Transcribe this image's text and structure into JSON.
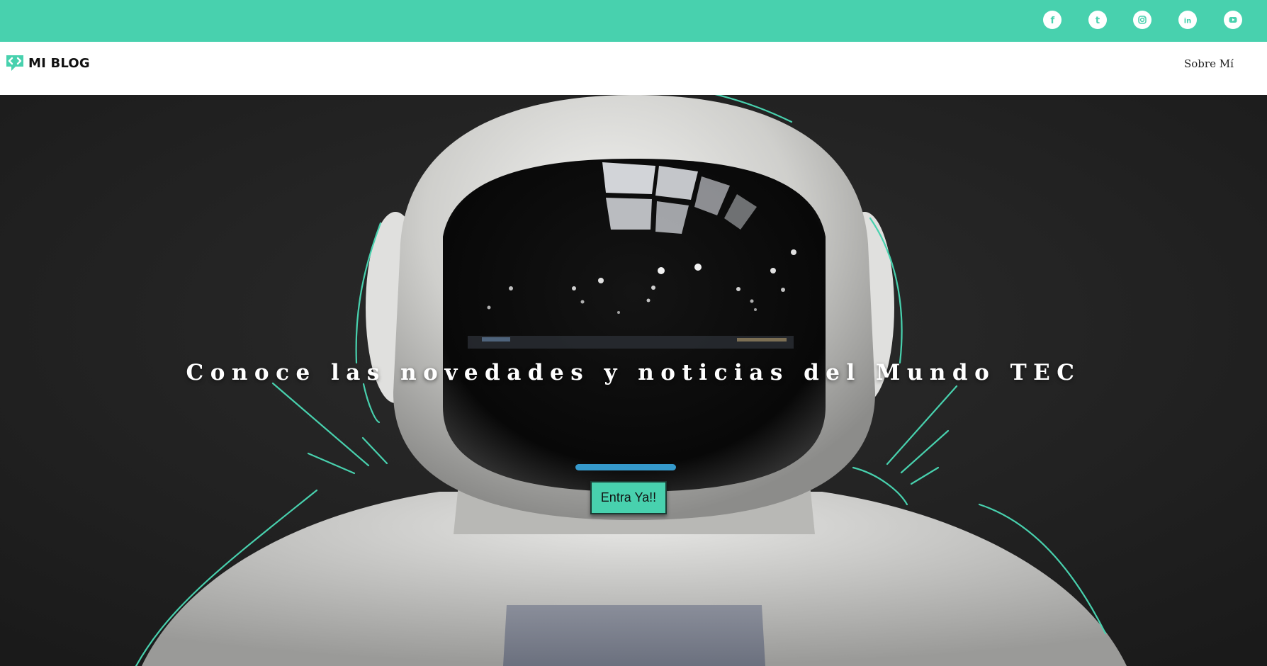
{
  "topbar": {
    "color": "#48d1ae",
    "social": [
      {
        "name": "facebook-icon",
        "glyph": "f"
      },
      {
        "name": "tumblr-icon",
        "glyph": "t"
      },
      {
        "name": "instagram-icon",
        "glyph": ""
      },
      {
        "name": "linkedin-icon",
        "glyph": "in"
      },
      {
        "name": "youtube-icon",
        "glyph": ""
      }
    ]
  },
  "navbar": {
    "logo_text": "MI BLOG",
    "logo_icon": "code-bubble-icon",
    "links": [
      {
        "label": "Sobre Mí"
      }
    ]
  },
  "hero": {
    "headline": "Conoce las novedades y noticias del Mundo TEC",
    "cta_label": "Entra Ya!!",
    "accent_color": "#48d1ae",
    "background": "astronaut-helmet-photo"
  }
}
